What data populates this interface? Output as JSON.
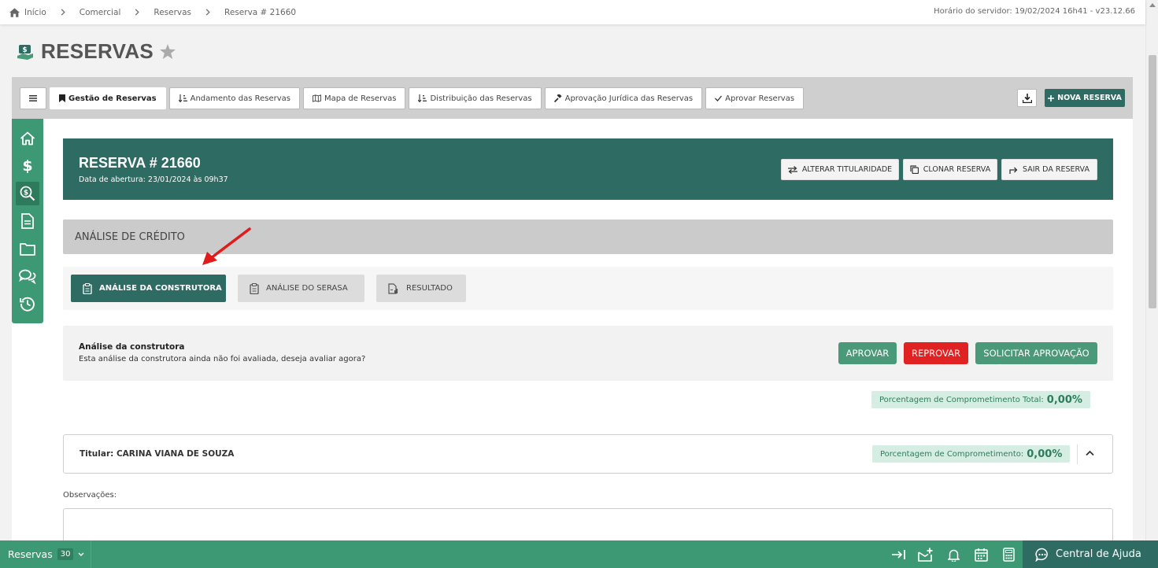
{
  "breadcrumb": {
    "items": [
      "Início",
      "Comercial",
      "Reservas",
      "Reserva # 21660"
    ]
  },
  "server_time": "Horário do servidor: 19/02/2024 16h41 - v23.12.66",
  "page": {
    "title": "RESERVAS"
  },
  "tabs": [
    {
      "label": "Gestão de Reservas",
      "icon": "bookmark-icon",
      "active": true
    },
    {
      "label": "Andamento das Reservas",
      "icon": "sort-icon"
    },
    {
      "label": "Mapa de Reservas",
      "icon": "map-icon"
    },
    {
      "label": "Distribuição das Reservas",
      "icon": "sort-icon"
    },
    {
      "label": "Aprovação Jurídica das Reservas",
      "icon": "gavel-icon"
    },
    {
      "label": "Aprovar Reservas",
      "icon": "check-icon"
    }
  ],
  "toolbar": {
    "nova_reserva": "NOVA RESERVA"
  },
  "sidenav": [
    "home-icon",
    "dollar-icon",
    "search-dollar-icon",
    "document-icon",
    "folder-icon",
    "comments-icon",
    "history-icon"
  ],
  "reserva": {
    "title": "RESERVA # 21660",
    "subtitle": "Data de abertura: 23/01/2024 às 09h37",
    "buttons": {
      "alterar": "ALTERAR TITULARIDADE",
      "clonar": "CLONAR RESERVA",
      "sair": "SAIR DA RESERVA"
    }
  },
  "section": {
    "title": "ANÁLISE DE CRÉDITO"
  },
  "subtabs": [
    {
      "label": "ANÁLISE DA CONSTRUTORA",
      "active": true
    },
    {
      "label": "ANÁLISE DO SERASA"
    },
    {
      "label": "RESULTADO"
    }
  ],
  "analise": {
    "title": "Análise da construtora",
    "text": "Esta análise da construtora ainda não foi avaliada, deseja avaliar agora?",
    "aprovar": "APROVAR",
    "reprovar": "REPROVAR",
    "solicitar": "SOLICITAR APROVAÇÃO"
  },
  "total_pct": {
    "label": "Porcentagem de Comprometimento Total:",
    "value": "0,00%"
  },
  "titular": {
    "name": "Titular: CARINA VIANA DE SOUZA",
    "pct_label": "Porcentagem de Comprometimento:",
    "pct_value": "0,00%"
  },
  "observacoes": {
    "label": "Observações:"
  },
  "bottombar": {
    "label": "Reservas",
    "count": "30",
    "help": "Central de Ajuda"
  },
  "colors": {
    "primary": "#2e6b62",
    "green": "#3d9874",
    "aprovar": "#4a9a7a",
    "reprovar": "#e02222",
    "badge_bg": "#d5ede3"
  }
}
